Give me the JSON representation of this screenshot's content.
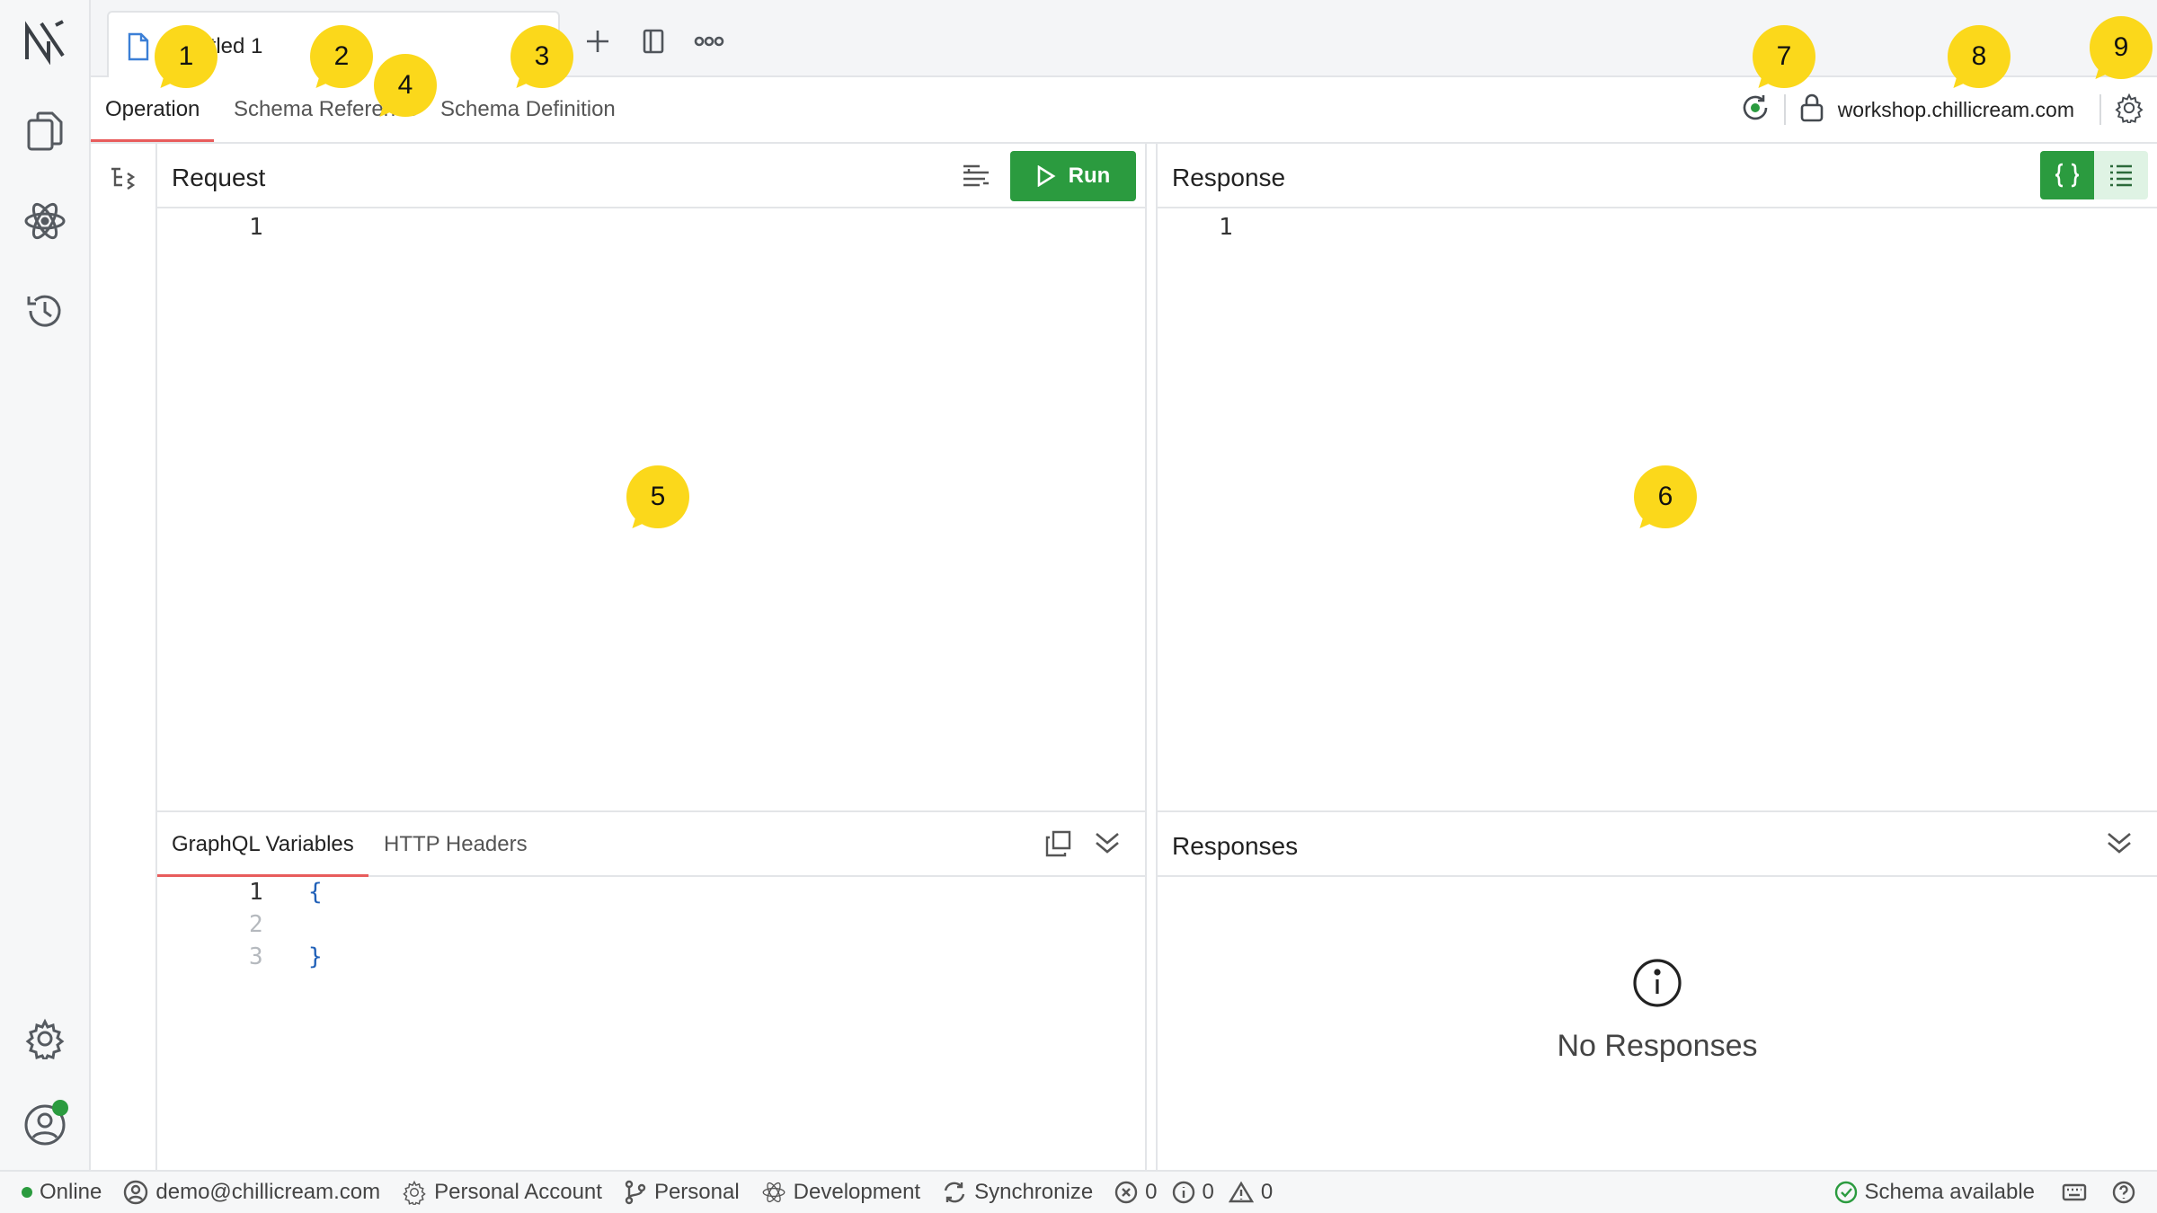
{
  "app": {
    "doc_tab_title": "Untitled 1",
    "endpoint": "workshop.chillicream.com"
  },
  "subnav": {
    "tabs": [
      "Operation",
      "Schema Reference",
      "Schema Definition"
    ],
    "active": "Operation"
  },
  "request": {
    "title": "Request",
    "run_label": "Run",
    "line_numbers": [
      "1"
    ]
  },
  "response": {
    "title": "Response",
    "line_numbers": [
      "1"
    ]
  },
  "variables": {
    "tabs": [
      "GraphQL Variables",
      "HTTP Headers"
    ],
    "line_numbers": [
      "1",
      "2",
      "3"
    ],
    "lines": [
      "{",
      "",
      "}"
    ]
  },
  "responses": {
    "title": "Responses",
    "empty_text": "No Responses"
  },
  "status": {
    "online": "Online",
    "user": "demo@chillicream.com",
    "account": "Personal Account",
    "workspace": "Personal",
    "environment": "Development",
    "sync": "Synchronize",
    "errors": "0",
    "infos": "0",
    "warnings": "0",
    "schema": "Schema available"
  },
  "callouts": [
    "1",
    "2",
    "3",
    "4",
    "5",
    "6",
    "7",
    "8",
    "9"
  ],
  "colors": {
    "accent_green": "#2b9b3f",
    "active_tab_underline": "#e85c5c",
    "callout": "#fbd81b"
  }
}
